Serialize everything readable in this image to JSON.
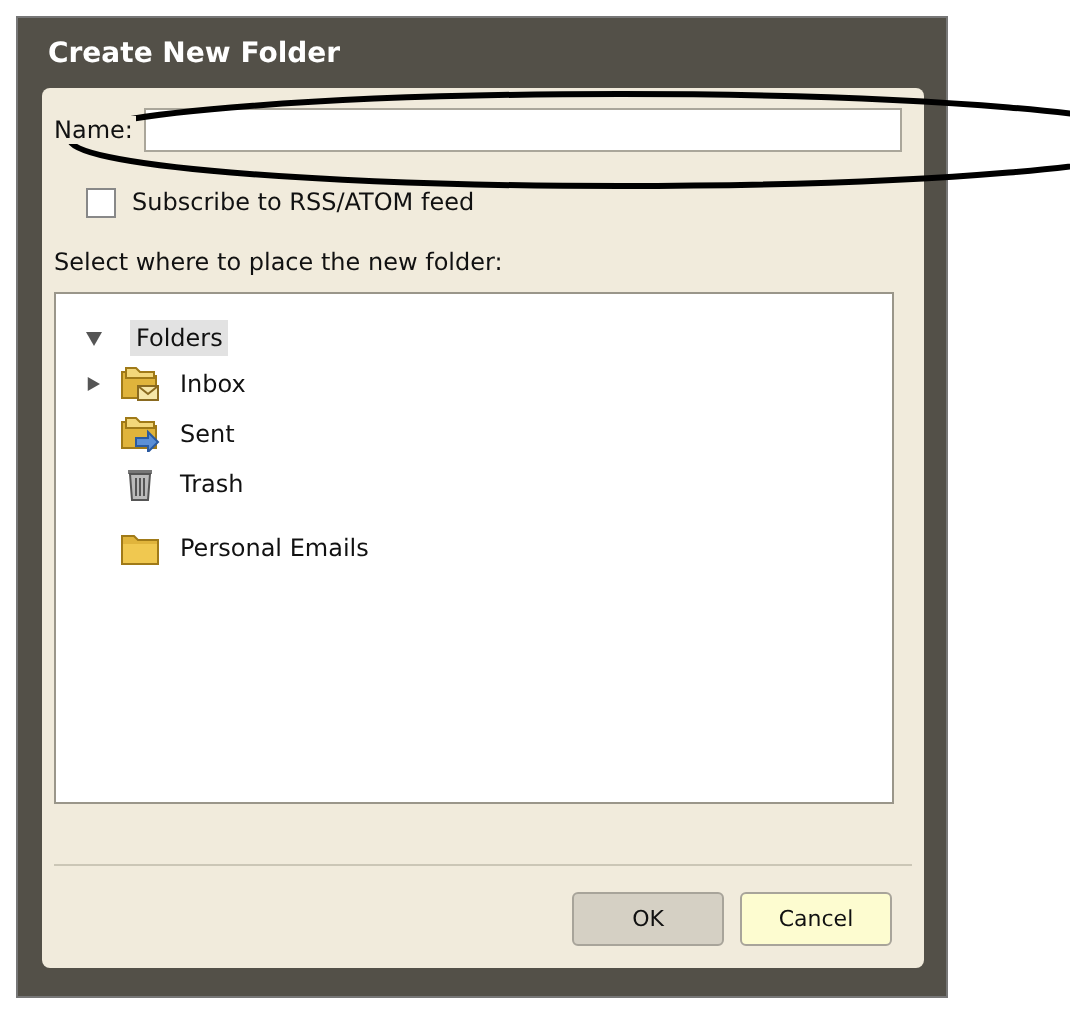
{
  "window": {
    "title": "Create New Folder"
  },
  "name_field": {
    "label": "Name:"
  },
  "subscribe": {
    "label": "Subscribe to RSS/ATOM feed",
    "checked": false
  },
  "tree_label": "Select where to place the new folder:",
  "tree": [
    {
      "label": "Folders",
      "expanded": true,
      "selected": true,
      "children": [
        {
          "label": "Inbox",
          "kind": "inbox",
          "expanded": false,
          "selected": false
        },
        {
          "label": "Sent",
          "kind": "sent",
          "selected": false
        },
        {
          "label": "Trash",
          "kind": "trash",
          "selected": false
        },
        {
          "label": "Personal Emails",
          "kind": "folder",
          "selected": false
        }
      ]
    }
  ],
  "buttons": [
    {
      "label": "OK",
      "kind": "default"
    },
    {
      "label": "Cancel",
      "kind": "focused"
    }
  ]
}
